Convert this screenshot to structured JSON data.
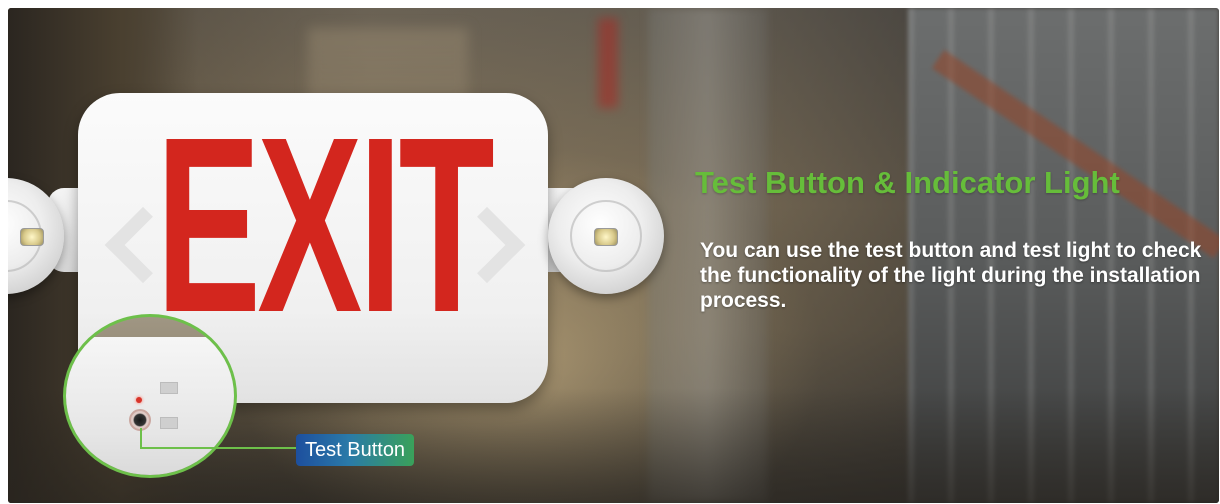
{
  "sign": {
    "text": "EXIT",
    "text_color": "#d3261e",
    "body_color": "#f2f2f2",
    "chevrons": [
      "chevron-left-icon",
      "chevron-right-icon"
    ],
    "lamps": [
      "lamp-head-left",
      "lamp-head-right"
    ]
  },
  "zoom": {
    "ring_color": "#6dc04a",
    "indicator_color": "#d8342a"
  },
  "callout": {
    "label": "Test Button",
    "gradient": [
      "#1d4f9e",
      "#3aa15a"
    ]
  },
  "feature": {
    "heading": "Test Button & Indicator Light",
    "heading_color": "#66bd3a",
    "description": "You can use the test button and test light to check the functionality of the light during the installation process."
  }
}
